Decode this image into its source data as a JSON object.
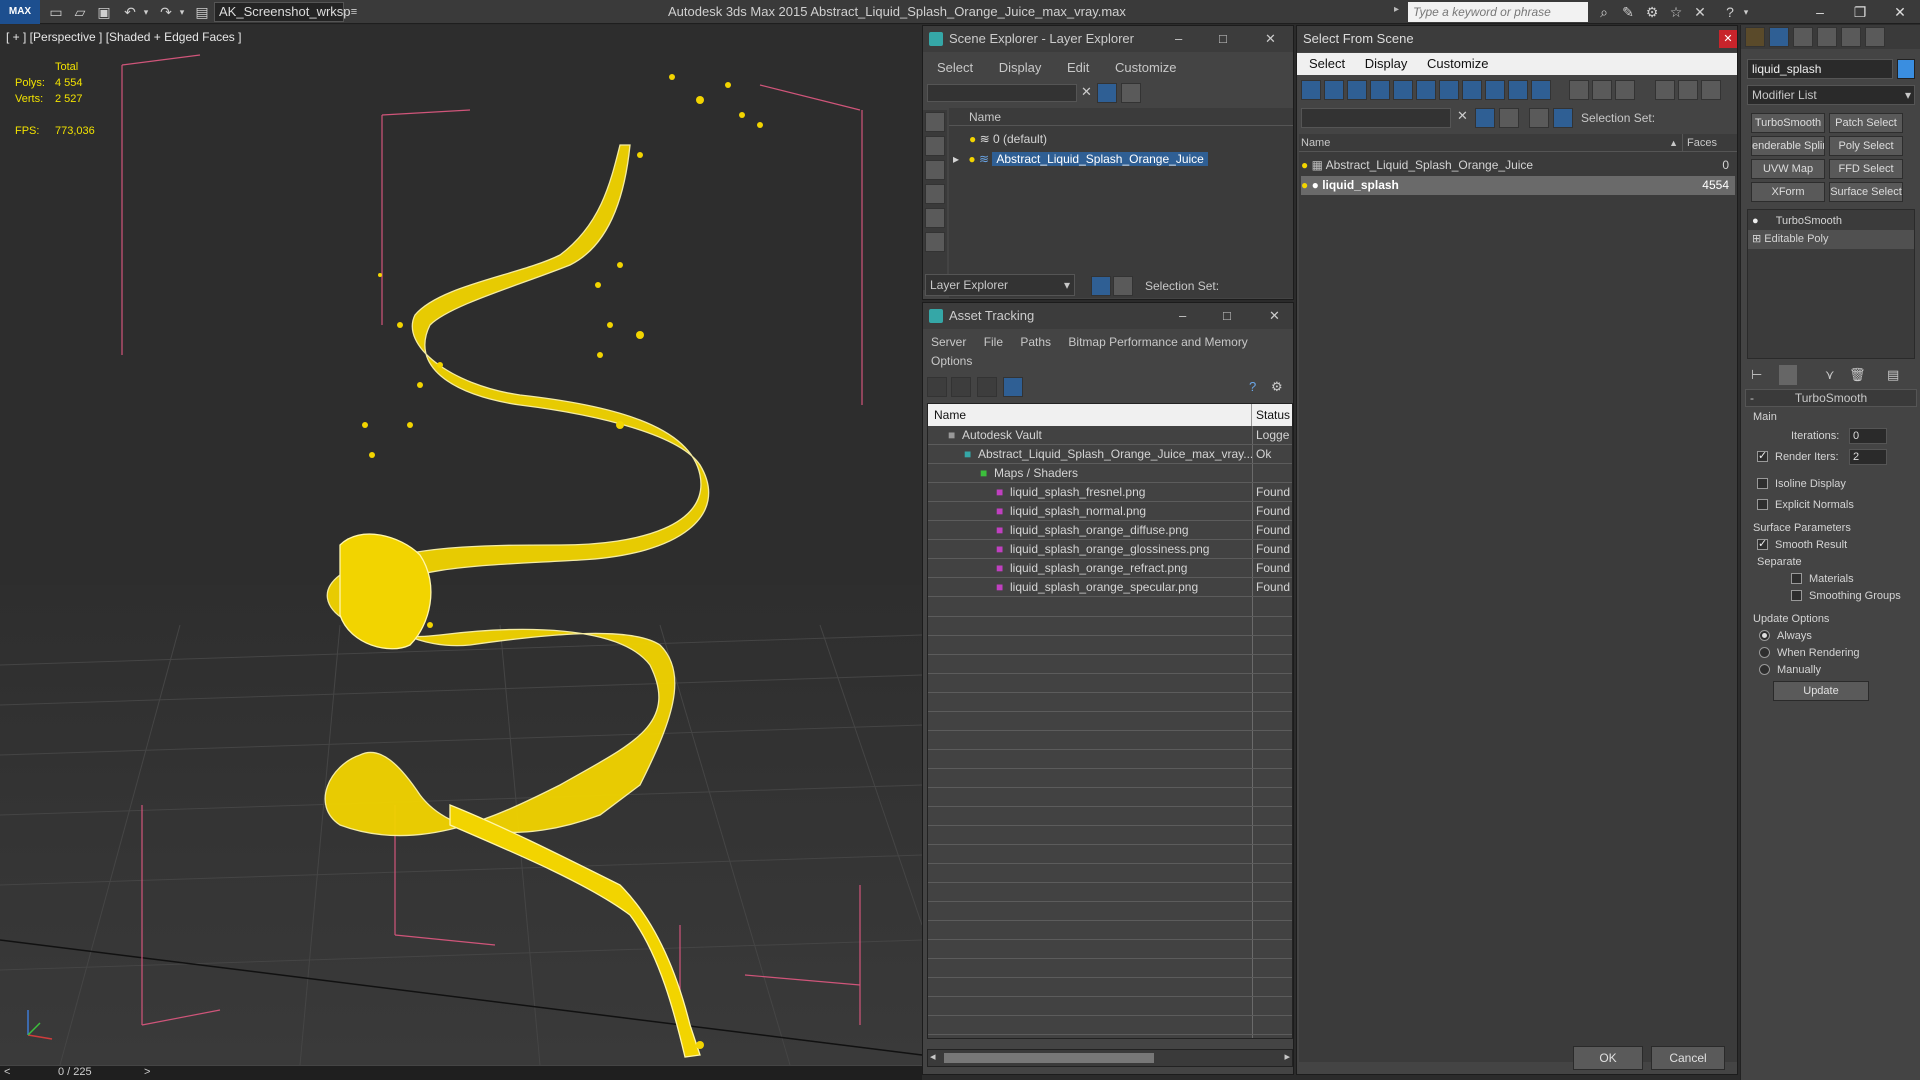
{
  "app": {
    "title": "Autodesk 3ds Max  2015    Abstract_Liquid_Splash_Orange_Juice_max_vray.max",
    "logo": "MAX",
    "workspace": "AK_Screenshot_wrksp",
    "search_placeholder": "Type a keyword or phrase"
  },
  "viewport": {
    "label": "[ + ] [Perspective ] [Shaded + Edged Faces ]",
    "stats": {
      "total_label": "Total",
      "polys_label": "Polys:",
      "polys_value": "4 554",
      "verts_label": "Verts:",
      "verts_value": "2 527",
      "fps_label": "FPS:",
      "fps_value": "773,036"
    },
    "time_slider": "0 / 225",
    "prev": "<",
    "next": ">"
  },
  "scene_explorer": {
    "title": "Scene Explorer - Layer Explorer",
    "menu": [
      "Select",
      "Display",
      "Edit",
      "Customize"
    ],
    "column_name": "Name",
    "rows": [
      "0 (default)",
      "Abstract_Liquid_Splash_Orange_Juice"
    ],
    "footer_dropdown": "Layer Explorer",
    "selection_set_label": "Selection Set:"
  },
  "asset_tracking": {
    "title": "Asset Tracking",
    "menu": [
      "Server",
      "File",
      "Paths",
      "Bitmap Performance and Memory"
    ],
    "menu2": "Options",
    "col_name": "Name",
    "col_status": "Status",
    "rows": [
      {
        "name": "Autodesk Vault",
        "status": "Logge",
        "indent": 0
      },
      {
        "name": "Abstract_Liquid_Splash_Orange_Juice_max_vray....",
        "status": "Ok",
        "indent": 1
      },
      {
        "name": "Maps / Shaders",
        "status": "",
        "indent": 2
      },
      {
        "name": "liquid_splash_fresnel.png",
        "status": "Found",
        "indent": 3
      },
      {
        "name": "liquid_splash_normal.png",
        "status": "Found",
        "indent": 3
      },
      {
        "name": "liquid_splash_orange_diffuse.png",
        "status": "Found",
        "indent": 3
      },
      {
        "name": "liquid_splash_orange_glossiness.png",
        "status": "Found",
        "indent": 3
      },
      {
        "name": "liquid_splash_orange_refract.png",
        "status": "Found",
        "indent": 3
      },
      {
        "name": "liquid_splash_orange_specular.png",
        "status": "Found",
        "indent": 3
      }
    ]
  },
  "select_from_scene": {
    "title": "Select From Scene",
    "menu": [
      "Select",
      "Display",
      "Customize"
    ],
    "selection_set_label": "Selection Set:",
    "col_name": "Name",
    "col_faces": "Faces",
    "rows": [
      {
        "name": "Abstract_Liquid_Splash_Orange_Juice",
        "faces": "0"
      },
      {
        "name": "liquid_splash",
        "faces": "4554"
      }
    ],
    "ok": "OK",
    "cancel": "Cancel"
  },
  "command_panel": {
    "object_name": "liquid_splash",
    "modifier_list": "Modifier List",
    "buttons": [
      "TurboSmooth",
      "Patch Select",
      "enderable Splir",
      "Poly Select",
      "UVW Map",
      "FFD Select",
      "XForm",
      "Surface Select"
    ],
    "stack": [
      "TurboSmooth",
      "Editable Poly"
    ],
    "rollout_title": "TurboSmooth",
    "main_label": "Main",
    "iterations_label": "Iterations:",
    "iterations_value": "0",
    "render_iters_label": "Render Iters:",
    "render_iters_value": "2",
    "isoline": "Isoline Display",
    "explicit_normals": "Explicit Normals",
    "surface_params": "Surface Parameters",
    "smooth_result": "Smooth Result",
    "separate": "Separate",
    "materials": "Materials",
    "smoothing_groups": "Smoothing Groups",
    "update_options": "Update Options",
    "always": "Always",
    "when_rendering": "When Rendering",
    "manually": "Manually",
    "update": "Update"
  },
  "colors": {
    "accent_blue": "#2f5f94",
    "mesh_yellow": "#f2d400",
    "stats_yellow": "#f2e200"
  }
}
